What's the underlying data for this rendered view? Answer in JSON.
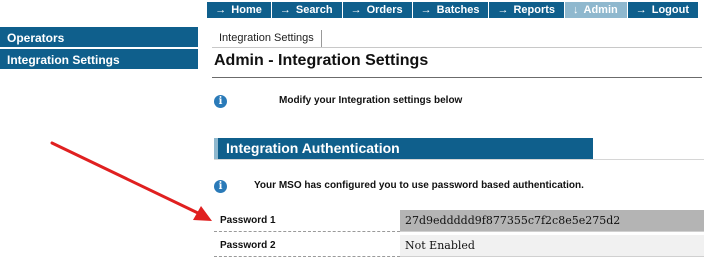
{
  "nav": {
    "items": [
      {
        "label": "Home",
        "active": false
      },
      {
        "label": "Search",
        "active": false
      },
      {
        "label": "Orders",
        "active": false
      },
      {
        "label": "Batches",
        "active": false
      },
      {
        "label": "Reports",
        "active": false
      },
      {
        "label": "Admin",
        "active": true
      },
      {
        "label": "Logout",
        "active": false
      }
    ]
  },
  "sidebar": {
    "items": [
      {
        "label": "Operators"
      },
      {
        "label": "Integration Settings"
      }
    ]
  },
  "tab": {
    "label": "Integration Settings"
  },
  "page_title": "Admin - Integration Settings",
  "intro_text": "Modify your Integration settings below",
  "section": {
    "title": "Integration Authentication",
    "info_text": "Your MSO has configured you to use password based authentication."
  },
  "fields": [
    {
      "label": "Password 1",
      "value": "27d9eddddd9f877355c7f2c8e5e275d2"
    },
    {
      "label": "Password 2",
      "value": "Not Enabled"
    }
  ],
  "colors": {
    "nav_blue": "#0f5f8c",
    "nav_active": "#8fb8ce",
    "annotation_arrow": "#e02020"
  }
}
